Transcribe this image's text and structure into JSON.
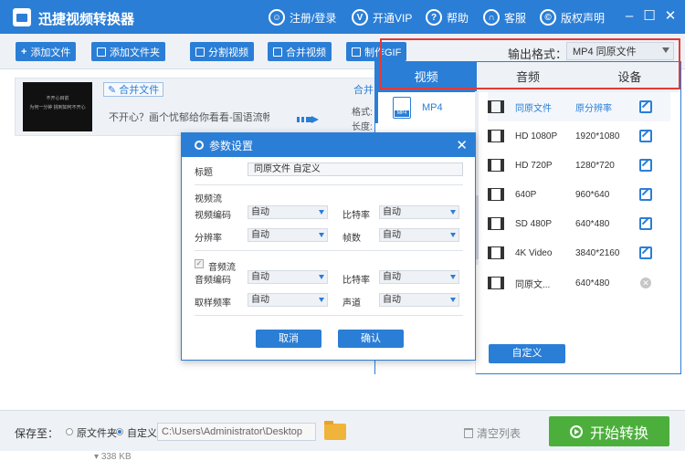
{
  "titlebar": {
    "app_title": "迅捷视频转换器",
    "register_login": "注册/登录",
    "open_vip": "开通VIP",
    "help": "帮助",
    "support": "客服",
    "copyright": "版权声明"
  },
  "toolbar": {
    "add_file": "添加文件",
    "add_folder": "添加文件夹",
    "split_video": "分割视频",
    "merge_video": "合并视频",
    "make_gif": "制作GIF",
    "output_format_label": "输出格式：",
    "output_format_value": "MP4  同原文件"
  },
  "file": {
    "merge_tag": "合并文件",
    "merge_tag2": "合并",
    "name": "不开心？画个忧郁给你看看-国语流畅",
    "thumb_line1": "不开心目前",
    "thumb_line2": "为何一分钟 挑到如何不开心",
    "format_label": "格式:",
    "length_label": "长度:",
    "size": "338 KB"
  },
  "format_popup": {
    "tabs": [
      "视频",
      "音频",
      "设备"
    ],
    "sidebar_selected": "MP4",
    "presets": [
      {
        "name": "同原文件",
        "res": "原分辨率",
        "action": "edit"
      },
      {
        "name": "HD 1080P",
        "res": "1920*1080",
        "action": "edit"
      },
      {
        "name": "HD 720P",
        "res": "1280*720",
        "action": "edit"
      },
      {
        "name": "640P",
        "res": "960*640",
        "action": "edit"
      },
      {
        "name": "SD 480P",
        "res": "640*480",
        "action": "edit"
      },
      {
        "name": "4K Video",
        "res": "3840*2160",
        "action": "edit"
      },
      {
        "name": "同原文...",
        "res": "640*480",
        "action": "delete"
      }
    ],
    "custom_button": "自定义"
  },
  "dialog": {
    "title": "参数设置",
    "title_label": "标题",
    "title_value": "同原文件 自定义",
    "video_stream": "视频流",
    "video_codec_label": "视频编码",
    "video_codec_value": "自动",
    "bitrate_label": "比特率",
    "bitrate_value": "自动",
    "resolution_label": "分辨率",
    "resolution_value": "自动",
    "framerate_label": "帧数",
    "framerate_value": "自动",
    "audio_stream": "音频流",
    "audio_codec_label": "音频编码",
    "audio_codec_value": "自动",
    "audio_bitrate_label": "比特率",
    "audio_bitrate_value": "自动",
    "samplerate_label": "取样频率",
    "samplerate_value": "自动",
    "channel_label": "声道",
    "channel_value": "自动",
    "cancel": "取消",
    "confirm": "确认"
  },
  "bottombar": {
    "save_to": "保存至：",
    "radio_original": "原文件夹",
    "radio_custom": "自定义",
    "path": "C:\\Users\\Administrator\\Desktop",
    "clear_list": "清空列表",
    "start": "开始转换"
  },
  "colors": {
    "accent": "#2b7ed6",
    "start_green": "#4caf3c",
    "highlight_red": "#e53935"
  }
}
